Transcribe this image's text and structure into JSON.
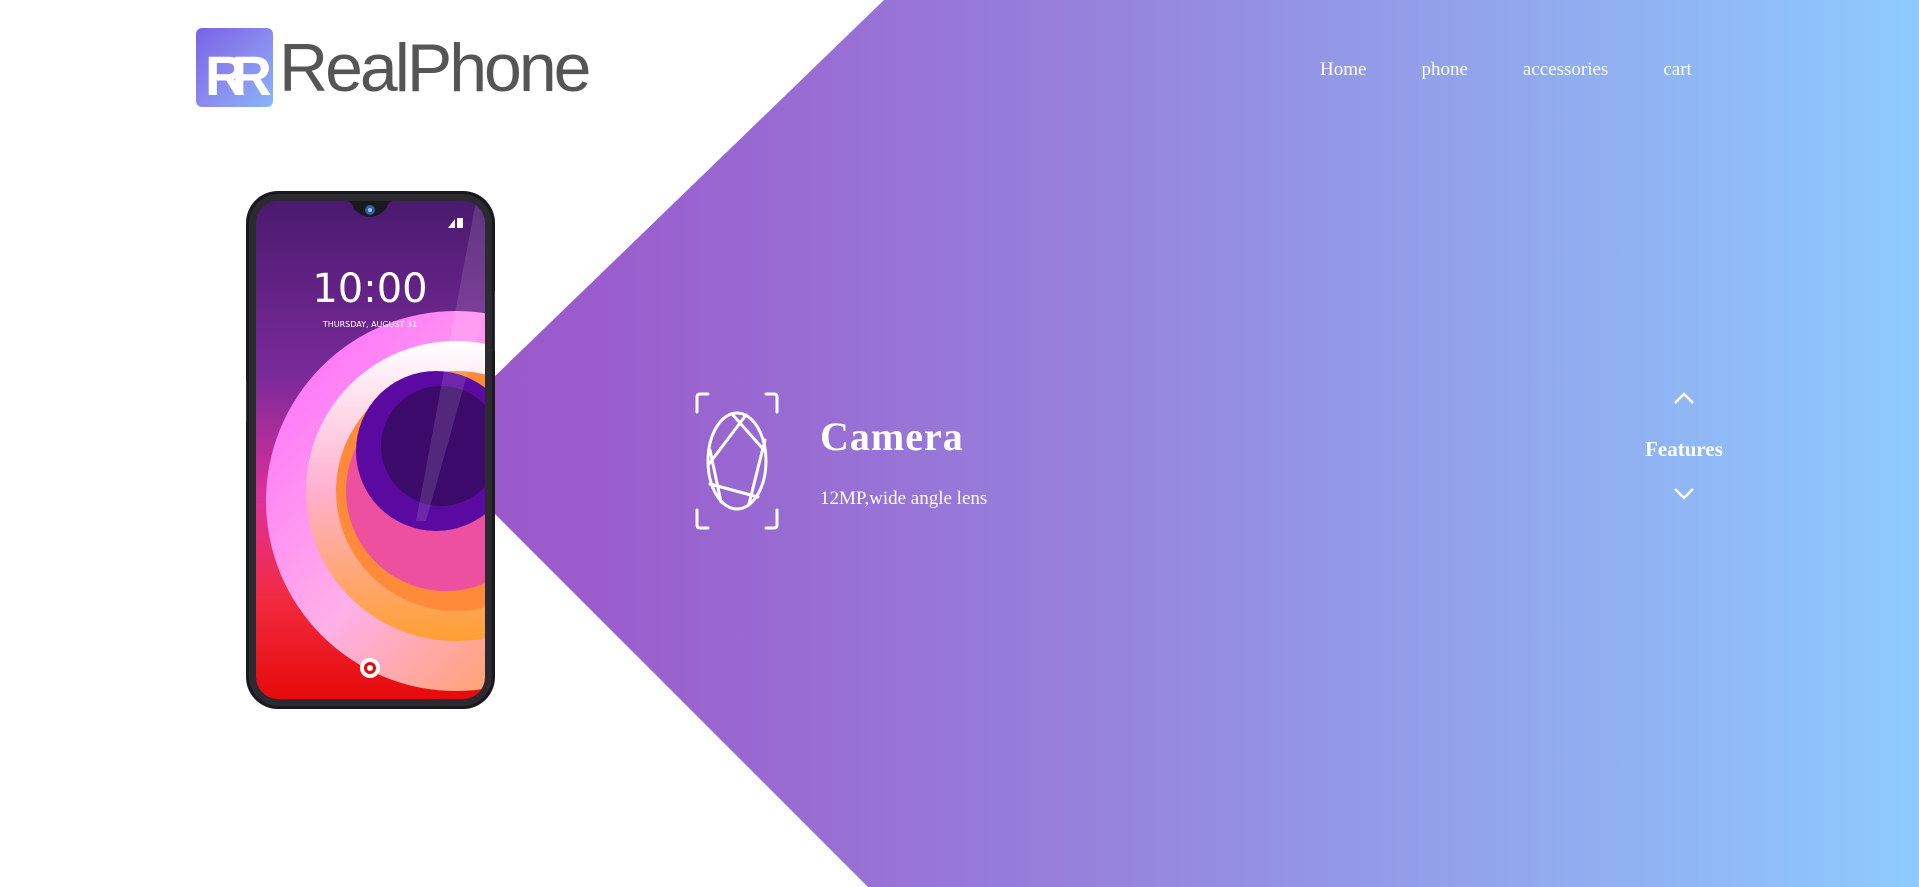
{
  "brand": {
    "name": "RealPhone",
    "mark_letters": "RR"
  },
  "nav": {
    "items": [
      {
        "label": "Home"
      },
      {
        "label": "phone"
      },
      {
        "label": "accessories"
      },
      {
        "label": "cart"
      }
    ]
  },
  "phone_screen": {
    "time": "10:00",
    "date": "THURSDAY, AUGUST 31"
  },
  "feature": {
    "icon": "camera-aperture-icon",
    "title": "Camera",
    "description": "12MP,wide angle lens"
  },
  "side_control": {
    "label": "Features",
    "up_icon": "chevron-up-icon",
    "down_icon": "chevron-down-icon"
  },
  "colors": {
    "gradient_start": "#9a56c6",
    "gradient_end": "#8ecbfe",
    "logo_text": "#555555",
    "text_on_gradient": "#ffffff"
  }
}
